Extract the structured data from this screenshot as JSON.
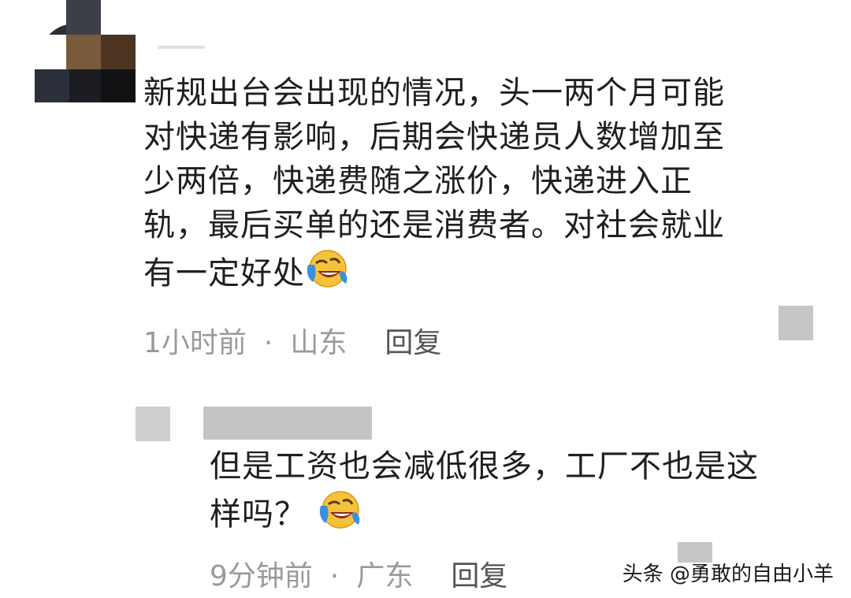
{
  "comments": [
    {
      "text_lines": [
        "新规出台会出现的情况，头一两个月可能",
        "对快递有影响，后期会快递员人数增加至",
        "少两倍，快递费随之涨价，快递进入正",
        "轨，最后买单的还是消费者。对社会就业",
        "有一定好处"
      ],
      "emoji": "laughing-crying-emoji",
      "time": "1小时前",
      "location": "山东",
      "reply_label": "回复"
    },
    {
      "text_lines": [
        "但是工资也会减低很多，工厂不也是这",
        "样吗？"
      ],
      "emoji": "laughing-crying-emoji",
      "time": "9分钟前",
      "location": "广东",
      "reply_label": "回复"
    }
  ],
  "separator": "·",
  "watermark": "头条 @勇敢的自由小羊",
  "colors": {
    "text": "#1f1f1f",
    "meta": "#9a9a9a",
    "reply": "#555555",
    "emoji_face": "#f6c23a",
    "emoji_tears": "#3b8fe0"
  }
}
